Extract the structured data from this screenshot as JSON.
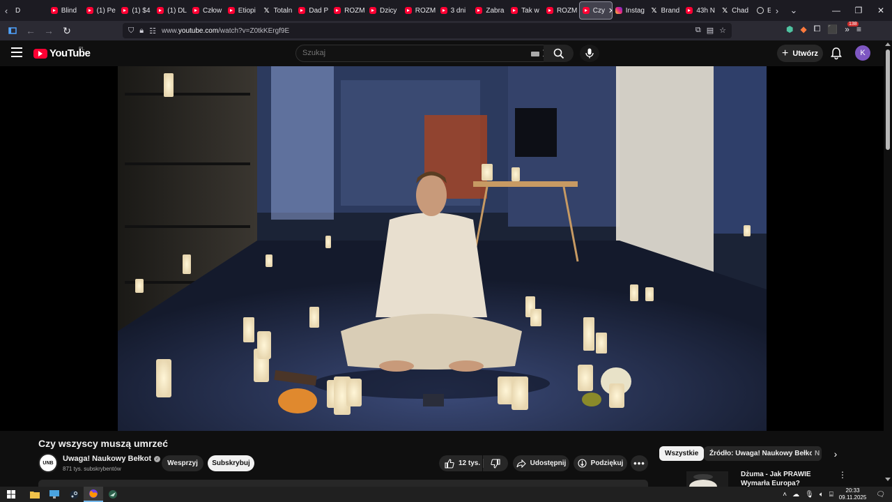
{
  "browser": {
    "tabs": [
      {
        "label": "D",
        "icon": "none"
      },
      {
        "label": "Blind",
        "icon": "youtube-icon"
      },
      {
        "label": "(1) Pe",
        "icon": "youtube-icon"
      },
      {
        "label": "(1) $4",
        "icon": "youtube-icon"
      },
      {
        "label": "(1) DL",
        "icon": "youtube-icon"
      },
      {
        "label": "Człow",
        "icon": "youtube-icon"
      },
      {
        "label": "Etiopi",
        "icon": "youtube-icon"
      },
      {
        "label": "Totaln",
        "icon": "x-icon"
      },
      {
        "label": "Dad P",
        "icon": "youtube-icon"
      },
      {
        "label": "ROZM",
        "icon": "youtube-icon"
      },
      {
        "label": "Dzicy",
        "icon": "youtube-icon"
      },
      {
        "label": "ROZM",
        "icon": "youtube-icon"
      },
      {
        "label": "3 dni",
        "icon": "youtube-icon"
      },
      {
        "label": "Zabra",
        "icon": "youtube-icon"
      },
      {
        "label": "Tak w",
        "icon": "youtube-icon"
      },
      {
        "label": "ROZM",
        "icon": "youtube-icon"
      },
      {
        "label": "Czy",
        "icon": "youtube-icon",
        "active": true
      },
      {
        "label": "Instag",
        "icon": "instagram-icon"
      },
      {
        "label": "Brand",
        "icon": "x-icon"
      },
      {
        "label": "43h N",
        "icon": "youtube-icon"
      },
      {
        "label": "Chad",
        "icon": "x-icon"
      },
      {
        "label": "Europ",
        "icon": "globe-icon"
      }
    ],
    "url_prefix": "www.",
    "url_domain": "youtube.com",
    "url_path": "/watch?v=Z0tkKErgf9E",
    "extension_badge": "138"
  },
  "youtube": {
    "logo_text": "YouTube",
    "country_code": "PL",
    "search_placeholder": "Szukaj",
    "create_label": "Utwórz",
    "avatar_letter": "K"
  },
  "video": {
    "title": "Czy wszyscy muszą umrzeć",
    "channel_name": "Uwaga! Naukowy Bełkot",
    "channel_avatar_text": "UNB",
    "subscribers": "871 tys. subskrybentów",
    "support_label": "Wesprzyj",
    "subscribe_label": "Subskrybuj",
    "likes": "12 tys.",
    "share_label": "Udostępnij",
    "thanks_label": "Podziękuj",
    "more_label": "•••"
  },
  "sidebar": {
    "chips": [
      "Wszystkie",
      "Źródło: Uwaga! Naukowy Bełkot",
      "N"
    ],
    "recommendation_title": "Dżuma - Jak PRAWIE Wymarła Europa?"
  },
  "taskbar": {
    "time": "20:33",
    "date": "09.11.2025"
  },
  "colors": {
    "youtube_red": "#ff0033",
    "page_bg": "#0f0f0f",
    "chip_bg": "#272727",
    "browser_tabbar": "#1c1b22",
    "browser_toolbar": "#2b2a33"
  }
}
